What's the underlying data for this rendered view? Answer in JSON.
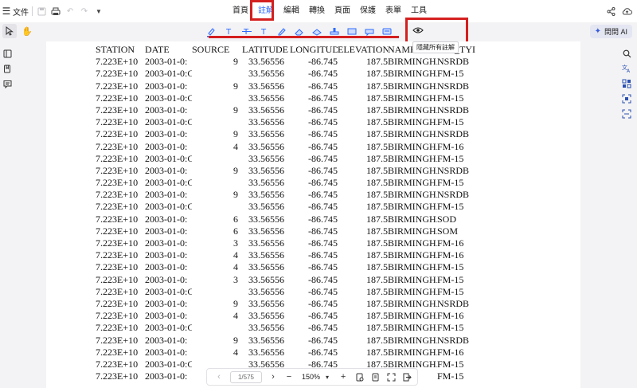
{
  "titlebar": {
    "file_label": "文件",
    "menus": [
      "首頁",
      "註解",
      "編輯",
      "轉換",
      "頁面",
      "保護",
      "表單",
      "工具"
    ],
    "active_menu": "註解"
  },
  "ai_button": {
    "label": "問問 AI"
  },
  "tooltip": {
    "text": "隱藏所有註解"
  },
  "annotation_tools": [
    {
      "name": "highlight-tool",
      "color": "#2f6bff"
    },
    {
      "name": "strikethrough-tool",
      "color": "#2f6bff"
    },
    {
      "name": "underline-tool",
      "color": "#2f6bff"
    },
    {
      "name": "squiggly-tool",
      "color": "#2f6bff"
    },
    {
      "name": "pencil-tool",
      "color": "#2f6bff"
    },
    {
      "name": "eraser-tool",
      "color": "#2f6bff"
    },
    {
      "name": "shape-tool",
      "color": "#2f6bff"
    },
    {
      "name": "stamp-tool",
      "color": "#2f6bff"
    },
    {
      "name": "text-box-tool",
      "color": "#2f6bff"
    },
    {
      "name": "note-tool",
      "color": "#2f6bff"
    },
    {
      "name": "attachment-tool",
      "color": "#2f6bff"
    }
  ],
  "colors": {
    "accent": "#2f6bff",
    "highlight_red": "#d41f1f"
  },
  "table": {
    "headers": [
      "STATION",
      "DATE",
      "SOURCE",
      "LATITUDE",
      "LONGITUDE",
      "ELEVATION",
      "NAME",
      "RPT_TYI"
    ],
    "rows": [
      [
        "7.223E+10",
        "2003-01-0:",
        "9",
        "33.56556",
        "-86.745",
        "187.5",
        "BIRMINGHAM",
        "NSRDB"
      ],
      [
        "7.223E+10",
        "2003-01-0:C",
        "",
        "33.56556",
        "-86.745",
        "187.5",
        "BIRMINGHAM",
        "FM-15"
      ],
      [
        "7.223E+10",
        "2003-01-0:",
        "9",
        "33.56556",
        "-86.745",
        "187.5",
        "BIRMINGHAM",
        "NSRDB"
      ],
      [
        "7.223E+10",
        "2003-01-0:C",
        "",
        "33.56556",
        "-86.745",
        "187.5",
        "BIRMINGHAM",
        "FM-15"
      ],
      [
        "7.223E+10",
        "2003-01-0:",
        "9",
        "33.56556",
        "-86.745",
        "187.5",
        "BIRMINGHAM",
        "NSRDB"
      ],
      [
        "7.223E+10",
        "2003-01-0:C",
        "",
        "33.56556",
        "-86.745",
        "187.5",
        "BIRMINGHAM",
        "FM-15"
      ],
      [
        "7.223E+10",
        "2003-01-0:",
        "9",
        "33.56556",
        "-86.745",
        "187.5",
        "BIRMINGHAM",
        "NSRDB"
      ],
      [
        "7.223E+10",
        "2003-01-0:",
        "4",
        "33.56556",
        "-86.745",
        "187.5",
        "BIRMINGHAM",
        "FM-16"
      ],
      [
        "7.223E+10",
        "2003-01-0:C",
        "",
        "33.56556",
        "-86.745",
        "187.5",
        "BIRMINGHAM",
        "FM-15"
      ],
      [
        "7.223E+10",
        "2003-01-0:",
        "9",
        "33.56556",
        "-86.745",
        "187.5",
        "BIRMINGHAM",
        "NSRDB"
      ],
      [
        "7.223E+10",
        "2003-01-0:C",
        "",
        "33.56556",
        "-86.745",
        "187.5",
        "BIRMINGHAM",
        "FM-15"
      ],
      [
        "7.223E+10",
        "2003-01-0:",
        "9",
        "33.56556",
        "-86.745",
        "187.5",
        "BIRMINGHAM",
        "NSRDB"
      ],
      [
        "7.223E+10",
        "2003-01-0:C",
        "",
        "33.56556",
        "-86.745",
        "187.5",
        "BIRMINGHAM",
        "FM-15"
      ],
      [
        "7.223E+10",
        "2003-01-0:",
        "6",
        "33.56556",
        "-86.745",
        "187.5",
        "BIRMINGHAM",
        "SOD"
      ],
      [
        "7.223E+10",
        "2003-01-0:",
        "6",
        "33.56556",
        "-86.745",
        "187.5",
        "BIRMINGHAM",
        "SOM"
      ],
      [
        "7.223E+10",
        "2003-01-0:",
        "3",
        "33.56556",
        "-86.745",
        "187.5",
        "BIRMINGHAM",
        "FM-16"
      ],
      [
        "7.223E+10",
        "2003-01-0:",
        "4",
        "33.56556",
        "-86.745",
        "187.5",
        "BIRMINGHAM",
        "FM-16"
      ],
      [
        "7.223E+10",
        "2003-01-0:",
        "4",
        "33.56556",
        "-86.745",
        "187.5",
        "BIRMINGHAM",
        "FM-15"
      ],
      [
        "7.223E+10",
        "2003-01-0:",
        "3",
        "33.56556",
        "-86.745",
        "187.5",
        "BIRMINGHAM",
        "FM-15"
      ],
      [
        "7.223E+10",
        "2003-01-0:C",
        "",
        "33.56556",
        "-86.745",
        "187.5",
        "BIRMINGHAM",
        "FM-15"
      ],
      [
        "7.223E+10",
        "2003-01-0:",
        "9",
        "33.56556",
        "-86.745",
        "187.5",
        "BIRMINGHAM",
        "NSRDB"
      ],
      [
        "7.223E+10",
        "2003-01-0:",
        "4",
        "33.56556",
        "-86.745",
        "187.5",
        "BIRMINGHAM",
        "FM-16"
      ],
      [
        "7.223E+10",
        "2003-01-0:C",
        "",
        "33.56556",
        "-86.745",
        "187.5",
        "BIRMINGHAM",
        "FM-15"
      ],
      [
        "7.223E+10",
        "2003-01-0:",
        "9",
        "33.56556",
        "-86.745",
        "187.5",
        "BIRMINGHAM",
        "NSRDB"
      ],
      [
        "7.223E+10",
        "2003-01-0:",
        "4",
        "33.56556",
        "-86.745",
        "187.5",
        "BIRMINGHAM",
        "FM-16"
      ],
      [
        "7.223E+10",
        "2003-01-0:C",
        "",
        "33.56556",
        "-86.745",
        "187.5",
        "BIRMINGHAM",
        "FM-15"
      ],
      [
        "7.223E+10",
        "2003-01-0:",
        "",
        "",
        "",
        "",
        "",
        "FM-15"
      ]
    ]
  },
  "pager": {
    "page_indicator": "1/575",
    "zoom": "150%"
  }
}
